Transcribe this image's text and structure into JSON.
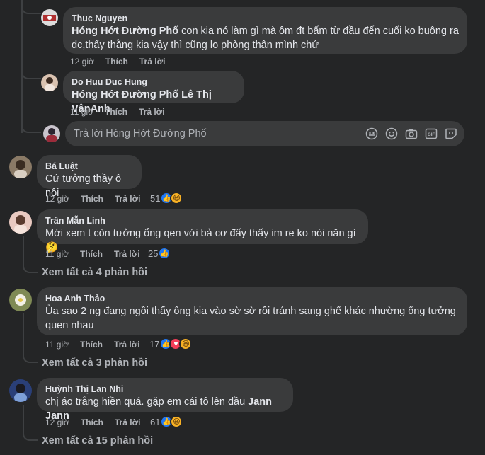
{
  "colors": {
    "background": "#242526",
    "bubble": "#3a3b3c",
    "text_primary": "#e4e6eb",
    "text_secondary": "#b0b3b8",
    "thread_line": "#3e4042",
    "like": "#2078f4",
    "love": "#f33e58",
    "haha": "#f7b125"
  },
  "comments": [
    {
      "author": "Thuc Nguyen",
      "mention": "Hóng Hớt Đường Phố",
      "text": " con kia nó làm gì mà ôm đt bấm từ đầu đến cuối ko buông ra",
      "text2": "dc,thấy thằng kia vậy thì cũng lo phòng thân mình chứ",
      "time": "12 giờ",
      "like_label": "Thích",
      "reply_label": "Trả lời"
    },
    {
      "author": "Do Huu Duc Hung",
      "mention": "Hóng Hớt Đường Phố",
      "mention2": " Lê Thị VânAnh",
      "time": "11 giờ",
      "like_label": "Thích",
      "reply_label": "Trả lời"
    },
    {
      "author": "Bá Luật",
      "text": "Cứ tưởng thầy ô nội",
      "time": "12 giờ",
      "like_label": "Thích",
      "reply_label": "Trả lời",
      "reaction_count": "51",
      "reactions": [
        "like-icon",
        "haha-icon"
      ]
    },
    {
      "author": "Trần Mẫn Linh",
      "text": "Mới xem t còn tưởng ổng qen với bả cơ đấy thấy im re ko nói năn gì",
      "emoji": "thinking-emoji",
      "time": "11 giờ",
      "like_label": "Thích",
      "reply_label": "Trả lời",
      "reaction_count": "25",
      "reactions": [
        "like-icon"
      ],
      "see_more": "Xem tất cả 4 phản hồi"
    },
    {
      "author": "Hoa Anh Thảo",
      "text": "Ủa sao 2 ng đang ngồi thấy ông kia vào sờ sờ rồi tránh sang ghế khác nhường ổng tưởng",
      "text2": "quen nhau",
      "time": "11 giờ",
      "like_label": "Thích",
      "reply_label": "Trả lời",
      "reaction_count": "17",
      "reactions": [
        "like-icon",
        "love-icon",
        "haha-icon"
      ],
      "see_more": "Xem tất cả 3 phản hồi"
    },
    {
      "author": "Huỳnh Thị Lan Nhi",
      "text": "chị áo trắng hiền quá. gặp em cái tô lên đầu ",
      "mention": "Jann Jann",
      "time": "12 giờ",
      "like_label": "Thích",
      "reply_label": "Trả lời",
      "reaction_count": "61",
      "reactions": [
        "like-icon",
        "haha-icon"
      ],
      "see_more": "Xem tất cả 15 phản hồi"
    }
  ],
  "reply_box": {
    "placeholder": "Trả lời Hóng Hớt Đường Phố",
    "icons": [
      "sticker-avatar-icon",
      "emoji-icon",
      "camera-icon",
      "gif-icon",
      "sticker-icon"
    ]
  }
}
